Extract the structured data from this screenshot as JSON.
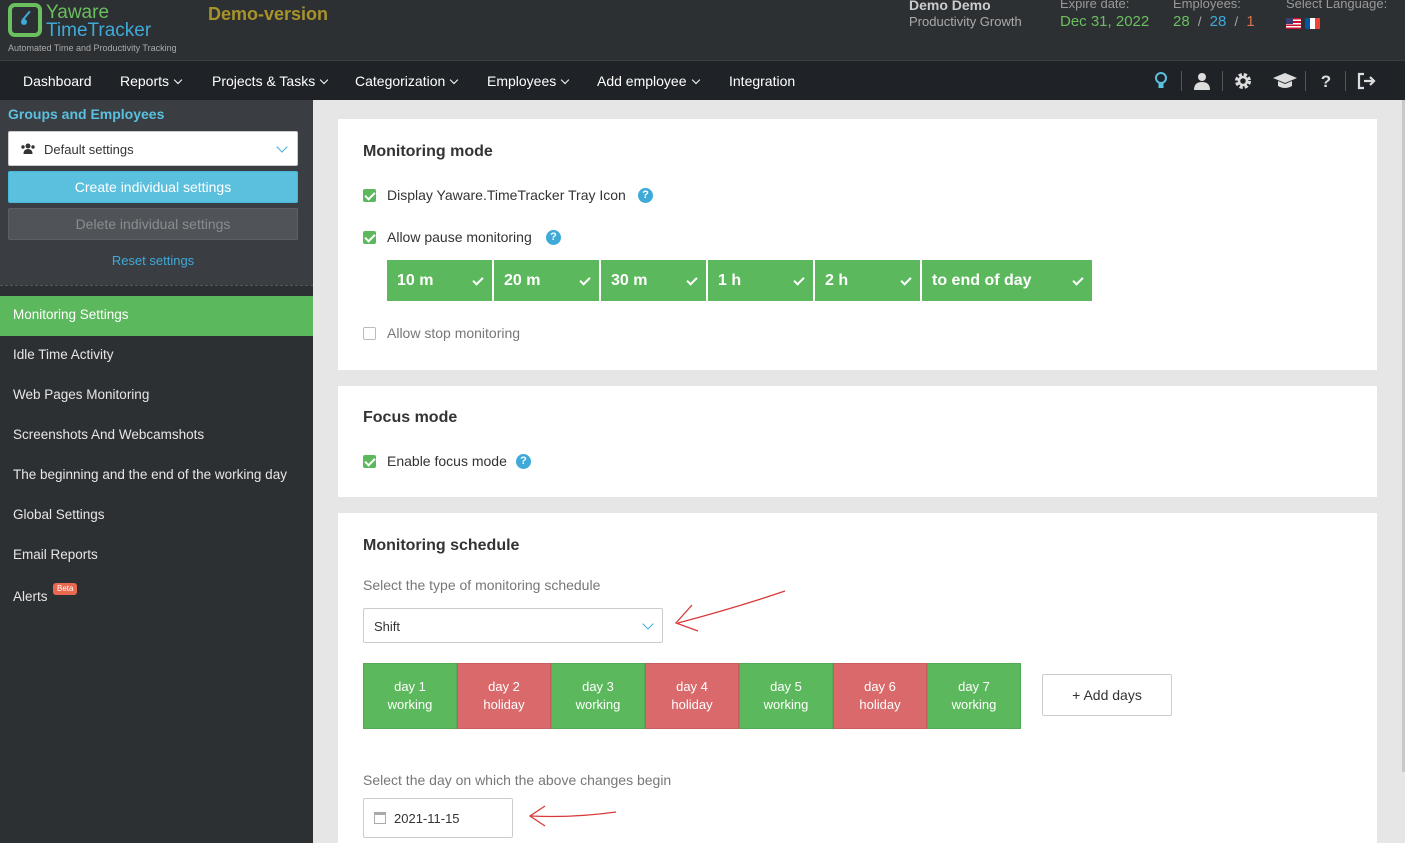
{
  "header": {
    "logo_line1": "Yaware",
    "logo_line2": "TimeTracker",
    "logo_sub": "Automated Time and Productivity Tracking",
    "demo_label": "Demo-version",
    "user_name": "Demo Demo",
    "plan": "Productivity Growth",
    "expire_label": "Expire date:",
    "expire_value": "Dec 31, 2022",
    "employees_label": "Employees:",
    "employees_a": "28",
    "employees_b": "28",
    "employees_c": "1",
    "slash": "/",
    "language_label": "Select Language:",
    "languages": [
      "us-flag",
      "fr-flag"
    ]
  },
  "nav": {
    "items": [
      "Dashboard",
      "Reports",
      "Projects & Tasks",
      "Categorization",
      "Employees",
      "Add employee",
      "Integration"
    ],
    "icons": [
      "lightbulb-icon",
      "user-icon",
      "gear-icon",
      "graduation-cap-icon",
      "question-icon",
      "logout-icon"
    ]
  },
  "sidebar": {
    "title": "Groups and Employees",
    "selected_group": "Default settings",
    "create_button": "Create individual settings",
    "delete_button": "Delete individual settings",
    "reset_link": "Reset settings",
    "menu": [
      {
        "label": "Monitoring Settings",
        "active": true
      },
      {
        "label": "Idle Time Activity"
      },
      {
        "label": "Web Pages Monitoring"
      },
      {
        "label": "Screenshots And Webcamshots"
      },
      {
        "label": "The beginning and the end of the working day"
      },
      {
        "label": "Global Settings"
      },
      {
        "label": "Email Reports"
      },
      {
        "label": "Alerts",
        "badge": "Beta"
      }
    ]
  },
  "monitoring_mode": {
    "title": "Monitoring mode",
    "tray_icon_label": "Display Yaware.TimeTracker Tray Icon",
    "tray_icon_checked": true,
    "pause_label": "Allow pause monitoring",
    "pause_checked": true,
    "pause_options": [
      "10 m",
      "20 m",
      "30 m",
      "1 h",
      "2 h",
      "to end of day"
    ],
    "stop_label": "Allow stop monitoring",
    "stop_checked": false
  },
  "focus_mode": {
    "title": "Focus mode",
    "enable_label": "Enable focus mode",
    "enable_checked": true
  },
  "schedule": {
    "title": "Monitoring schedule",
    "type_label": "Select the type of monitoring schedule",
    "type_value": "Shift",
    "days": [
      {
        "name": "day 1",
        "status": "working"
      },
      {
        "name": "day 2",
        "status": "holiday"
      },
      {
        "name": "day 3",
        "status": "working"
      },
      {
        "name": "day 4",
        "status": "holiday"
      },
      {
        "name": "day 5",
        "status": "working"
      },
      {
        "name": "day 6",
        "status": "holiday"
      },
      {
        "name": "day 7",
        "status": "working"
      }
    ],
    "add_days_button": "+ Add days",
    "start_label": "Select the day on which the above changes begin",
    "start_date": "2021-11-15"
  },
  "colors": {
    "green": "#5cb85c",
    "holiday_red": "#d9696a",
    "accent_blue": "#5bc0de",
    "demo_gold": "#a8922a",
    "annotation_arrow": "#d83a3a"
  }
}
